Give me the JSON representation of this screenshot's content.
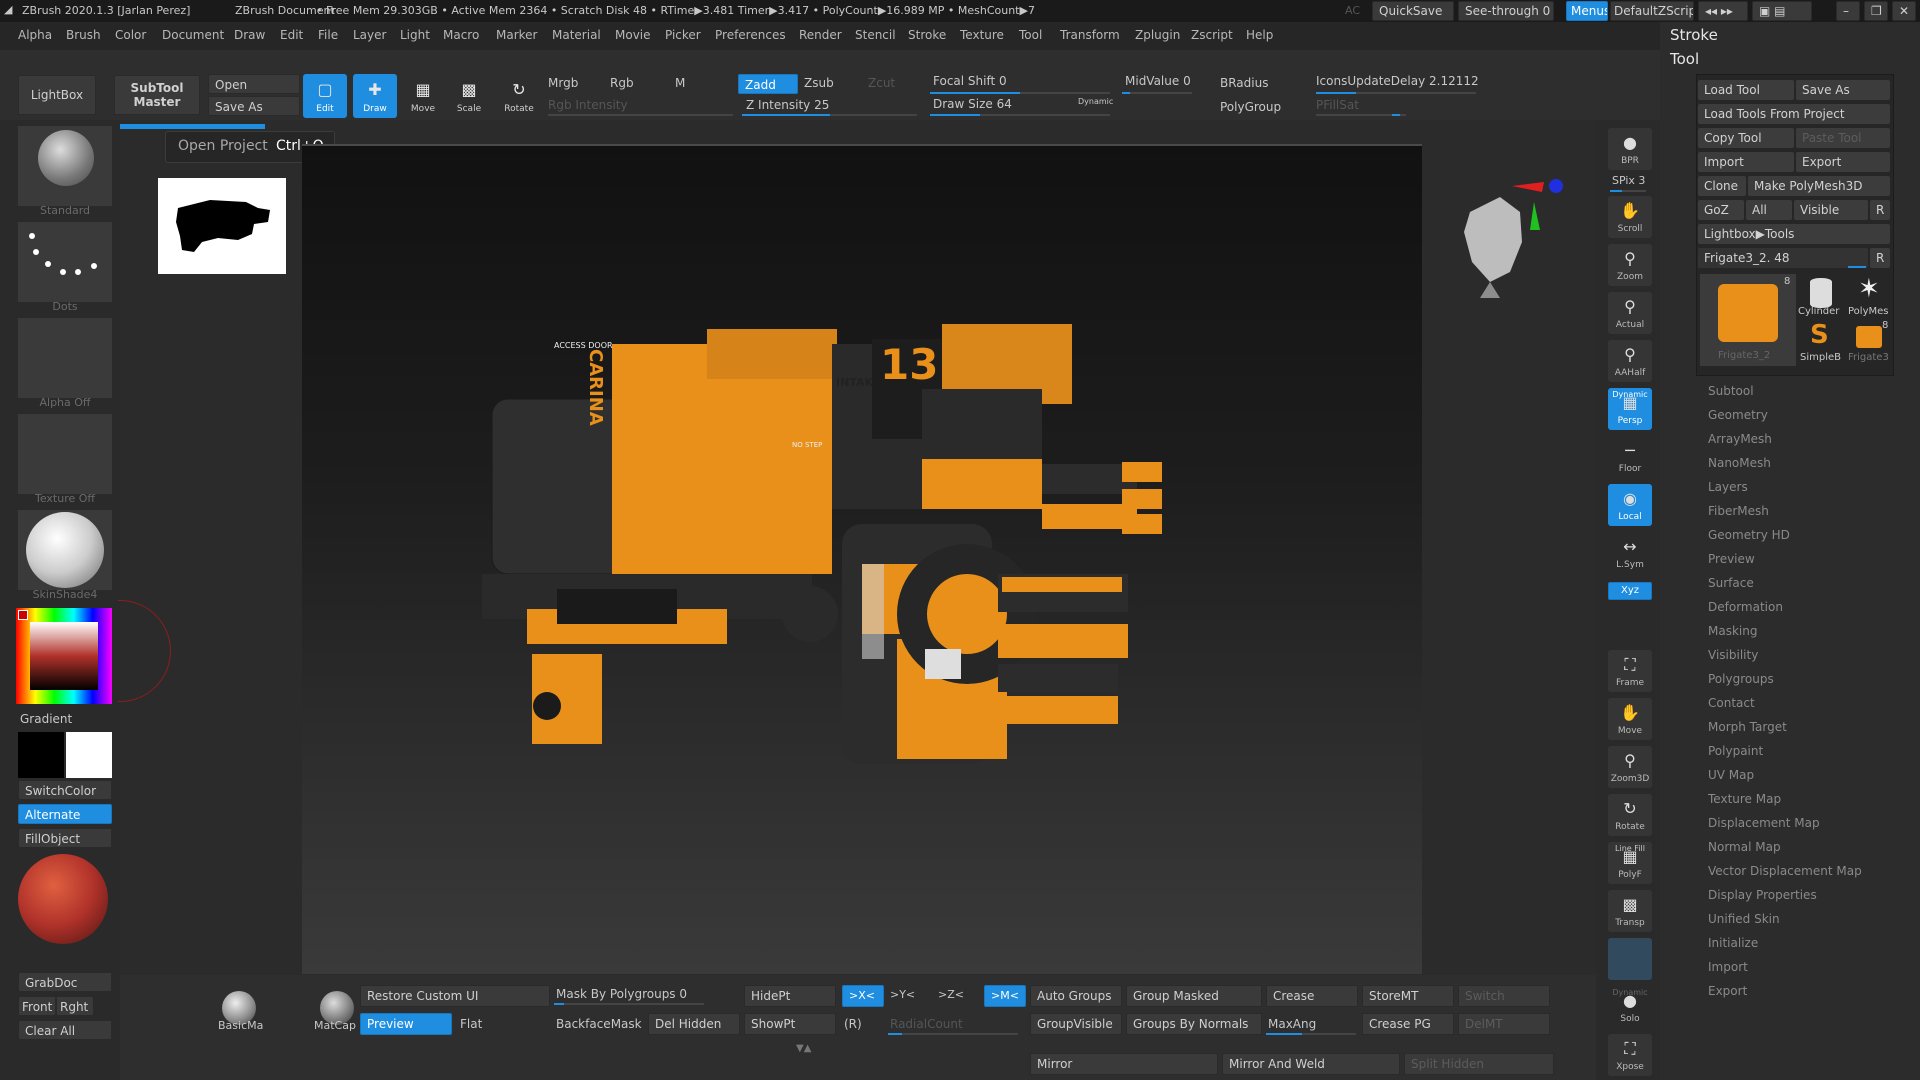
{
  "titlebar": {
    "app": "ZBrush 2020.1.3 [Jarlan Perez]",
    "doc": "ZBrush Document",
    "stats": "• Free Mem 29.303GB • Active Mem 2364 • Scratch Disk 48 •  RTime▶3.481 Timer▶3.417 • PolyCount▶16.989 MP  • MeshCount▶7",
    "ac": "AC",
    "quicksave": "QuickSave",
    "seethrough": "See-through  0",
    "menus": "Menus",
    "zscript": "DefaultZScript"
  },
  "menu": [
    "Alpha",
    "Brush",
    "Color",
    "Document",
    "Draw",
    "Edit",
    "File",
    "Layer",
    "Light",
    "Macro",
    "Marker",
    "Material",
    "Movie",
    "Picker",
    "Preferences",
    "Render",
    "Stencil",
    "Stroke",
    "Texture",
    "Tool",
    "Transform",
    "Zplugin",
    "Zscript",
    "Help"
  ],
  "toolbar": {
    "lightbox": "LightBox",
    "subtool_master": "SubTool\nMaster",
    "open": "Open",
    "save_as": "Save As",
    "edit": "Edit",
    "draw": "Draw",
    "move": "Move",
    "scale": "Scale",
    "rotate": "Rotate",
    "mrgb": "Mrgb",
    "rgb": "Rgb",
    "m": "M",
    "rgb_intensity": "Rgb Intensity",
    "zadd": "Zadd",
    "zsub": "Zsub",
    "zcut": "Zcut",
    "z_intensity": "Z Intensity 25",
    "focal_shift": "Focal Shift 0",
    "draw_size": "Draw Size 64",
    "dynamic": "Dynamic",
    "midvalue": "MidValue 0",
    "bradius": "BRadius",
    "polygroup": "PolyGroup",
    "icons_delay": "IconsUpdateDelay 2.12112",
    "pfillsat": "PFillSat"
  },
  "tooltip": {
    "label": "Open Project",
    "shortcut": "Ctrl+O"
  },
  "left": {
    "brush": "Standard",
    "stroke": "Dots",
    "alpha": "Alpha Off",
    "texture": "Texture Off",
    "material": "SkinShade4",
    "gradient": "Gradient",
    "switchcolor": "SwitchColor",
    "alternate": "Alternate",
    "fillobject": "FillObject",
    "grabdoc": "GrabDoc",
    "front": "Front",
    "right": "Rght",
    "clearall": "Clear All"
  },
  "model_text": {
    "access": "ACCESS DOOR",
    "carina": "CARINA",
    "number": "13",
    "intake": "INTAK",
    "nostep": "NO STEP"
  },
  "rightshelf": [
    "BPR",
    "SPix 3",
    "Scroll",
    "Zoom",
    "Actual",
    "AAHalf",
    "Persp",
    "Floor",
    "Local",
    "L.Sym",
    "Xyz",
    "Frame",
    "Move",
    "Zoom3D",
    "Rotate",
    "PolyF",
    "Transp",
    "Solo",
    "Xpose"
  ],
  "rightshelf_extra": {
    "dynamic": "Dynamic",
    "line_fill": "Line Fill",
    "dynamic2": "Dynamic"
  },
  "panel": {
    "stroke": "Stroke",
    "tool": "Tool",
    "buttons": {
      "load_tool": "Load Tool",
      "save_as": "Save As",
      "load_from_project": "Load Tools From Project",
      "copy_tool": "Copy Tool",
      "paste_tool": "Paste Tool",
      "import": "Import",
      "export": "Export",
      "clone": "Clone",
      "make_polymesh": "Make PolyMesh3D",
      "goz": "GoZ",
      "all": "All",
      "visible": "Visible",
      "r": "R",
      "lightbox_tools": "Lightbox▶Tools",
      "current_tool": "Frigate3_2. 48",
      "r2": "R"
    },
    "thumbs": [
      "Frigate3_2",
      "Cylinder",
      "PolyMes",
      "SimpleB",
      "Frigate3"
    ],
    "thumb_counts": [
      "8",
      "8"
    ],
    "subpalettes": [
      "Subtool",
      "Geometry",
      "ArrayMesh",
      "NanoMesh",
      "Layers",
      "FiberMesh",
      "Geometry HD",
      "Preview",
      "Surface",
      "Deformation",
      "Masking",
      "Visibility",
      "Polygroups",
      "Contact",
      "Morph Target",
      "Polypaint",
      "UV Map",
      "Texture Map",
      "Displacement Map",
      "Normal Map",
      "Vector Displacement Map",
      "Display Properties",
      "Unified Skin",
      "Initialize",
      "Import",
      "Export"
    ]
  },
  "bottom": {
    "basic": "BasicMa",
    "matcap": "MatCap",
    "restore": "Restore Custom UI",
    "preview": "Preview",
    "flat": "Flat",
    "mask_poly": "Mask By Polygroups 0",
    "backface": "BackfaceMask",
    "del_hidden": "Del Hidden",
    "hidept": "HidePt",
    "showpt": "ShowPt",
    "x": ">X<",
    "y": ">Y<",
    "z": ">Z<",
    "m": ">M<",
    "r": "(R)",
    "radialcount": "RadialCount",
    "auto_groups": "Auto Groups",
    "group_visible": "GroupVisible",
    "group_masked": "Group Masked",
    "groups_normals": "Groups By Normals",
    "crease": "Crease",
    "maxang": "MaxAng",
    "storemt": "StoreMT",
    "crease_pg": "Crease PG",
    "switch": "Switch",
    "delmt": "DelMT",
    "mirror": "Mirror",
    "mirror_weld": "Mirror And Weld",
    "split_hidden": "Split Hidden"
  },
  "colors": {
    "accent": "#1f8ee0",
    "model_orange": "#e8901a",
    "model_dark": "#2e2e2e",
    "main_color": "#b0322a"
  }
}
